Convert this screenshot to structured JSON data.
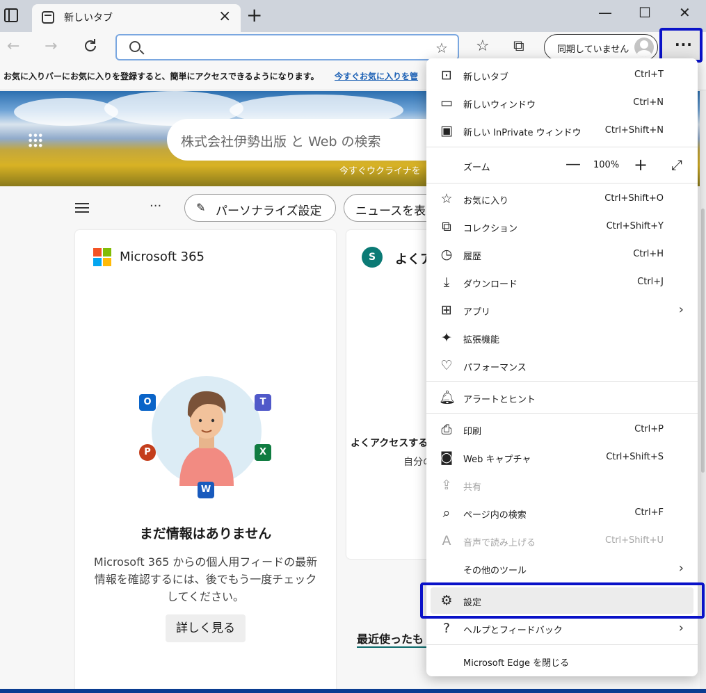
{
  "tab": {
    "title": "新しいタブ"
  },
  "window": {
    "minimize": "—",
    "maximize": "☐",
    "close": "✕"
  },
  "toolbar": {
    "back": "←",
    "forward": "→",
    "profile_label": "同期していません",
    "more_label": "···"
  },
  "favbar": {
    "text": "お気に入りバーにお気に入りを登録すると、簡単にアクセスできるようになります。",
    "link": "今すぐお気に入りを管"
  },
  "hero": {
    "search_placeholder": "株式会社伊勢出版 と Web の検索",
    "caption": "今すぐウクライナを"
  },
  "feed": {
    "personalize": "パーソナライズ設定",
    "news": "ニュースを表"
  },
  "card_m365": {
    "title": "Microsoft 365",
    "empty_title": "まだ情報はありません",
    "empty_desc": "Microsoft 365 からの個人用フィードの最新情報を確認するには、後でもう一度チェックしてください。",
    "more": "詳しく見る"
  },
  "card_sp": {
    "title": "よくア",
    "text": "よくアクセスする",
    "sub": "自分の"
  },
  "recent": "最近使ったも",
  "menu": {
    "items": [
      {
        "label": "新しいタブ",
        "key": "Ctrl+T"
      },
      {
        "label": "新しいウィンドウ",
        "key": "Ctrl+N"
      },
      {
        "label": "新しい InPrivate ウィンドウ",
        "key": "Ctrl+Shift+N"
      },
      {
        "label": "ズーム",
        "key": ""
      },
      {
        "label": "お気に入り",
        "key": "Ctrl+Shift+O"
      },
      {
        "label": "コレクション",
        "key": "Ctrl+Shift+Y"
      },
      {
        "label": "履歴",
        "key": "Ctrl+H"
      },
      {
        "label": "ダウンロード",
        "key": "Ctrl+J"
      },
      {
        "label": "アプリ",
        "key": ""
      },
      {
        "label": "拡張機能",
        "key": ""
      },
      {
        "label": "パフォーマンス",
        "key": ""
      },
      {
        "label": "アラートとヒント",
        "key": ""
      },
      {
        "label": "印刷",
        "key": "Ctrl+P"
      },
      {
        "label": "Web キャプチャ",
        "key": "Ctrl+Shift+S"
      },
      {
        "label": "共有",
        "key": ""
      },
      {
        "label": "ページ内の検索",
        "key": "Ctrl+F"
      },
      {
        "label": "音声で読み上げる",
        "key": "Ctrl+Shift+U"
      },
      {
        "label": "その他のツール",
        "key": ""
      },
      {
        "label": "設定",
        "key": ""
      },
      {
        "label": "ヘルプとフィードバック",
        "key": ""
      },
      {
        "label": "Microsoft Edge を閉じる",
        "key": ""
      }
    ],
    "zoom_value": "100%"
  },
  "colors": {
    "highlight": "#0a12c8",
    "accent": "#1a5fb4"
  }
}
